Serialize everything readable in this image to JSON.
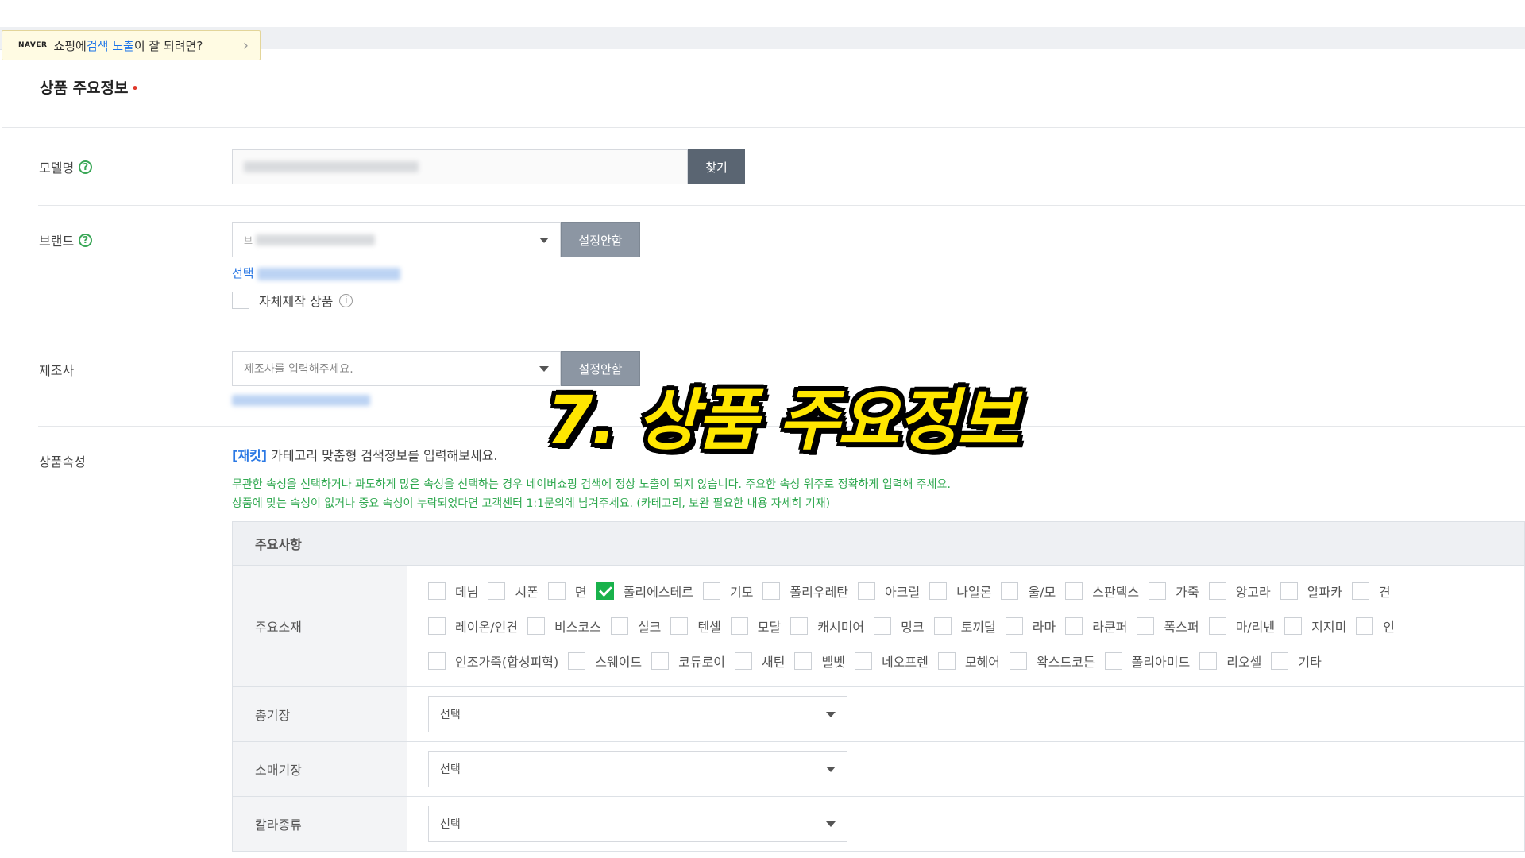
{
  "notice": {
    "brand": "NAVER",
    "text_pre": "쇼핑에 ",
    "text_hl": "검색 노출",
    "text_post": "이 잘 되려면?",
    "chevron": "›"
  },
  "section": {
    "title": "상품 주요정보",
    "required_mark": "•"
  },
  "model": {
    "label": "모델명",
    "help": "?",
    "find_button": "찾기"
  },
  "brand": {
    "label": "브랜드",
    "help": "?",
    "selected_placeholder": "브",
    "setting_button": "설정안함",
    "link_text": "선택",
    "self_made_label": "자체제작 상품",
    "info": "i"
  },
  "maker": {
    "label": "제조사",
    "placeholder": "제조사를 입력해주세요.",
    "setting_button": "설정안함"
  },
  "attributes": {
    "label": "상품속성",
    "tag": "[재킷]",
    "intro": " 카테고리 맞춤형 검색정보를 입력해보세요.",
    "warn1": "무관한 속성을 선택하거나 과도하게 많은 속성을 선택하는 경우 네이버쇼핑 검색에 정상 노출이 되지 않습니다. 주요한 속성 위주로 정확하게 입력해 주세요.",
    "warn2": "상품에 맞는 속성이 없거나 중요 속성이 누락되었다면 고객센터 1:1문의에 남겨주세요. (카테고리, 보완 필요한 내용 자세히 기재)",
    "table_header": "주요사항",
    "material_label": "주요소재",
    "materials_row1": [
      "데님",
      "시폰",
      "면",
      "폴리에스테르",
      "기모",
      "폴리우레탄",
      "아크릴",
      "나일론",
      "울/모",
      "스판덱스",
      "가죽",
      "앙고라",
      "알파카",
      "견"
    ],
    "materials_row2": [
      "레이온/인견",
      "비스코스",
      "실크",
      "텐셀",
      "모달",
      "캐시미어",
      "밍크",
      "토끼털",
      "라마",
      "라쿤퍼",
      "폭스퍼",
      "마/리넨",
      "지지미",
      "인"
    ],
    "materials_row3": [
      "인조가죽(합성피혁)",
      "스웨이드",
      "코듀로이",
      "새틴",
      "벨벳",
      "네오프렌",
      "모헤어",
      "왁스드코튼",
      "폴리아미드",
      "리오셀",
      "기타"
    ],
    "checked_material": "폴리에스테르",
    "selects": [
      {
        "label": "총기장",
        "value": "선택"
      },
      {
        "label": "소매기장",
        "value": "선택"
      },
      {
        "label": "칼라종류",
        "value": "선택"
      }
    ]
  },
  "overlay": {
    "title": "7. 상품 주요정보"
  }
}
